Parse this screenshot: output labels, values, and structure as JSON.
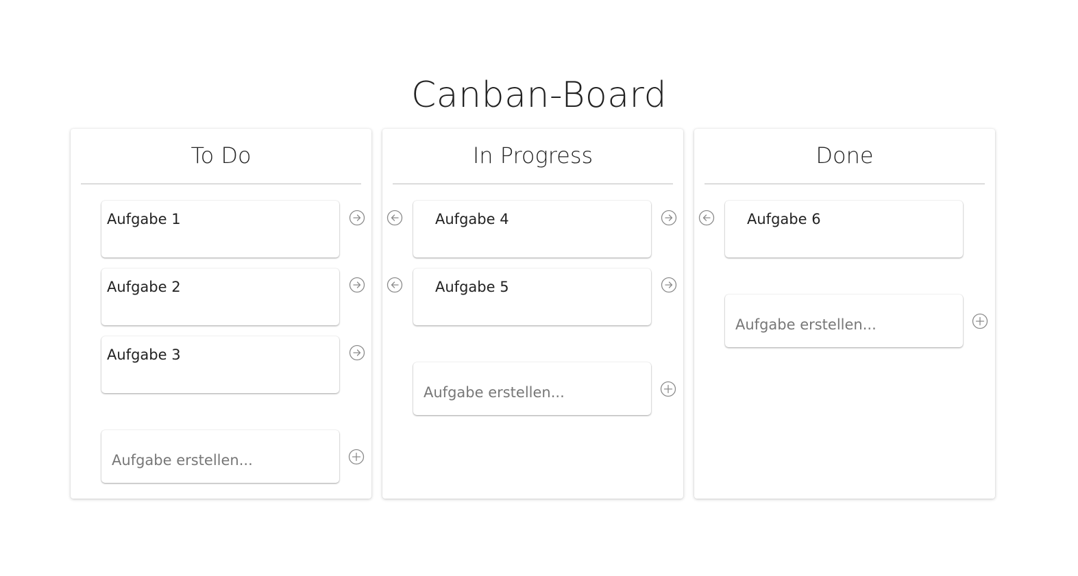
{
  "page": {
    "title": "Canban-Board"
  },
  "colors": {
    "text": "#222222",
    "divider": "#bdbdbd",
    "icon": "#8a8a8a",
    "placeholder": "#777777"
  },
  "columns": [
    {
      "title": "To Do",
      "cards": [
        {
          "label": "Aufgabe 1"
        },
        {
          "label": "Aufgabe 2"
        },
        {
          "label": "Aufgabe 3"
        }
      ],
      "new_task_placeholder": "Aufgabe erstellen...",
      "new_task_value": ""
    },
    {
      "title": "In Progress",
      "cards": [
        {
          "label": "Aufgabe 4"
        },
        {
          "label": "Aufgabe 5"
        }
      ],
      "new_task_placeholder": "Aufgabe erstellen...",
      "new_task_value": ""
    },
    {
      "title": "Done",
      "cards": [
        {
          "label": "Aufgabe 6"
        }
      ],
      "new_task_placeholder": "Aufgabe erstellen...",
      "new_task_value": ""
    }
  ],
  "icons": {
    "move_right": "arrow-right-circle-icon",
    "move_left": "arrow-left-circle-icon",
    "add": "plus-circle-icon"
  }
}
